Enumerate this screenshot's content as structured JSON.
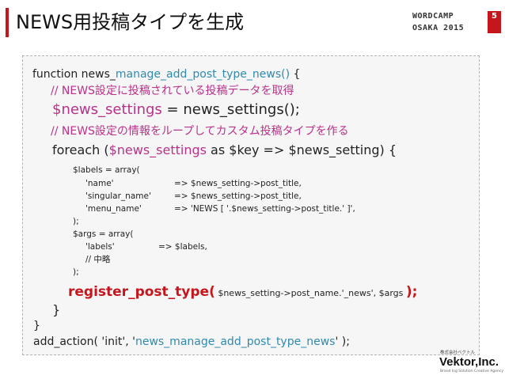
{
  "slide": {
    "title": "NEWS用投稿タイプを生成"
  },
  "event_logo": {
    "line1": "WORDCAMP",
    "line2": "OSAKA 2015",
    "mark": "5"
  },
  "code": {
    "l1": {
      "a": "function news_",
      "b": "manage_add_post_type_news()",
      "c": " {"
    },
    "l2": {
      "text": "// NEWS設定に投稿されている投稿データを取得"
    },
    "l3": {
      "a": "$news_settings",
      "b": " = news_settings();"
    },
    "l4": {
      "text": "// NEWS設定の情報をループしてカスタム投稿タイプを作る"
    },
    "l5": {
      "a": "foreach (",
      "b": "$news_settings",
      "c": " as $key => $news_setting) {"
    },
    "l6": {
      "text": "$labels = array("
    },
    "l7": {
      "key": "'name'",
      "value": "=> $news_setting->post_title,"
    },
    "l8": {
      "key": "'singular_name'",
      "value": "=> $news_setting->post_title,"
    },
    "l9": {
      "key": "'menu_name'",
      "value": "=> 'NEWS [ '.$news_setting->post_title.' ]',"
    },
    "l10": {
      "text": ");"
    },
    "l11": {
      "text": "$args = array("
    },
    "l12": {
      "key": "'labels'",
      "value": "=> $labels,"
    },
    "l13": {
      "text": "// 中略"
    },
    "l14": {
      "text": ");"
    },
    "l15": {
      "a": "register_post_type(",
      "b": " $news_setting->post_name.'_news', $args ",
      "c": ");"
    },
    "l16": {
      "text": "}"
    },
    "l17": {
      "text": "}"
    },
    "l18": {
      "a": "add_action( 'init', '",
      "b": "news_manage_add_post_type_news",
      "c": "' );"
    }
  },
  "vektor_logo": {
    "tagline": "株式会社ベクトル",
    "name": "Vektor,Inc.",
    "sub": "Brand Ing Solution Creative Agency"
  },
  "colors": {
    "accent": "#c4161c",
    "keyword_blue": "#2f8ab0",
    "comment_magenta": "#b8328a",
    "code_background": "#f6f6f6"
  }
}
